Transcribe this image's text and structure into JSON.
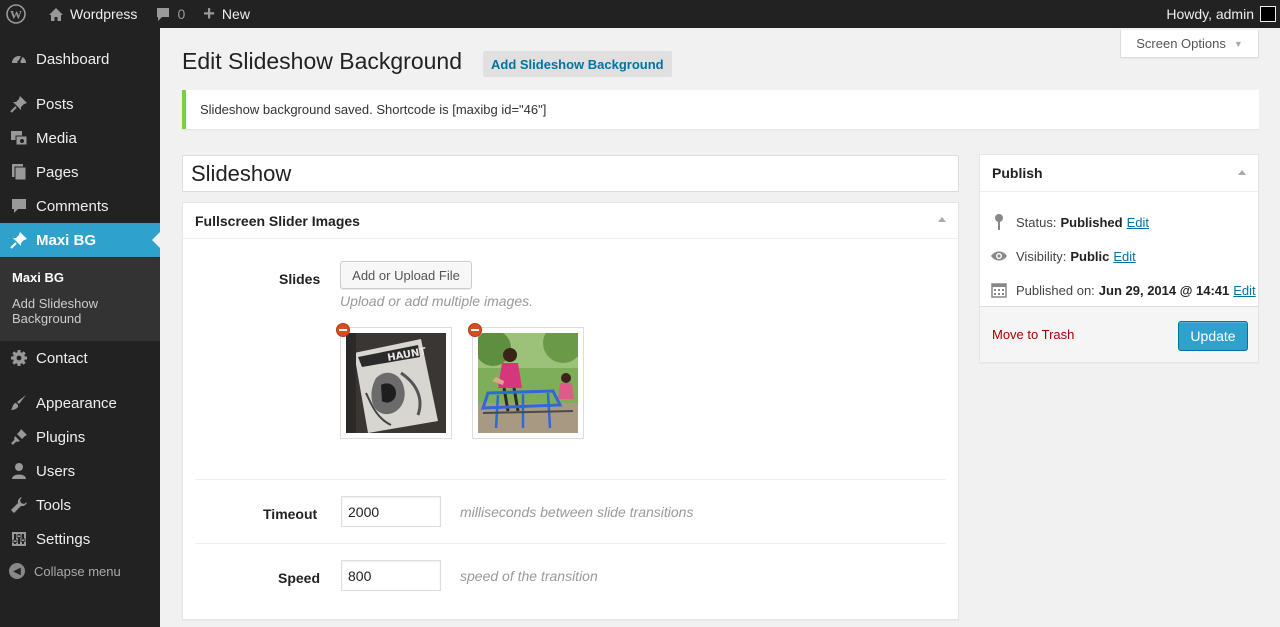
{
  "adminbar": {
    "site_name": "Wordpress",
    "comments_count": "0",
    "new_label": "New",
    "howdy": "Howdy, admin"
  },
  "sidebar": {
    "items": [
      {
        "label": "Dashboard",
        "icon": "dashboard-icon"
      },
      {
        "label": "Posts",
        "icon": "pin-icon"
      },
      {
        "label": "Media",
        "icon": "media-icon"
      },
      {
        "label": "Pages",
        "icon": "pages-icon"
      },
      {
        "label": "Comments",
        "icon": "comment-icon"
      },
      {
        "label": "Maxi BG",
        "icon": "pin-icon"
      },
      {
        "label": "Contact",
        "icon": "gear-icon"
      },
      {
        "label": "Appearance",
        "icon": "brush-icon"
      },
      {
        "label": "Plugins",
        "icon": "plug-icon"
      },
      {
        "label": "Users",
        "icon": "user-icon"
      },
      {
        "label": "Tools",
        "icon": "wrench-icon"
      },
      {
        "label": "Settings",
        "icon": "sliders-icon"
      }
    ],
    "submenu": [
      "Maxi BG",
      "Add Slideshow Background"
    ],
    "collapse": "Collapse menu"
  },
  "header": {
    "title": "Edit Slideshow Background",
    "add_new": "Add Slideshow Background",
    "screen_options": "Screen Options"
  },
  "notice": "Slideshow background saved. Shortcode is [maxibg id=\"46\"]",
  "post_title": "Slideshow",
  "metabox": {
    "title": "Fullscreen Slider Images",
    "slides_label": "Slides",
    "upload_button": "Add or Upload File",
    "upload_hint": "Upload or add multiple images.",
    "timeout_label": "Timeout",
    "timeout_value": "2000",
    "timeout_desc": "milliseconds between slide transitions",
    "speed_label": "Speed",
    "speed_value": "800",
    "speed_desc": "speed of the transition"
  },
  "publish": {
    "title": "Publish",
    "status_label": "Status:",
    "status_value": "Published",
    "visibility_label": "Visibility:",
    "visibility_value": "Public",
    "published_label": "Published on:",
    "published_value": "Jun 29, 2014 @ 14:41",
    "edit": "Edit",
    "trash": "Move to Trash",
    "update": "Update"
  },
  "colors": {
    "accent": "#2ea2cc",
    "sidebar_bg": "#222222",
    "notice_border": "#7ad03a",
    "link": "#0074a2",
    "trash": "#aa0000"
  }
}
